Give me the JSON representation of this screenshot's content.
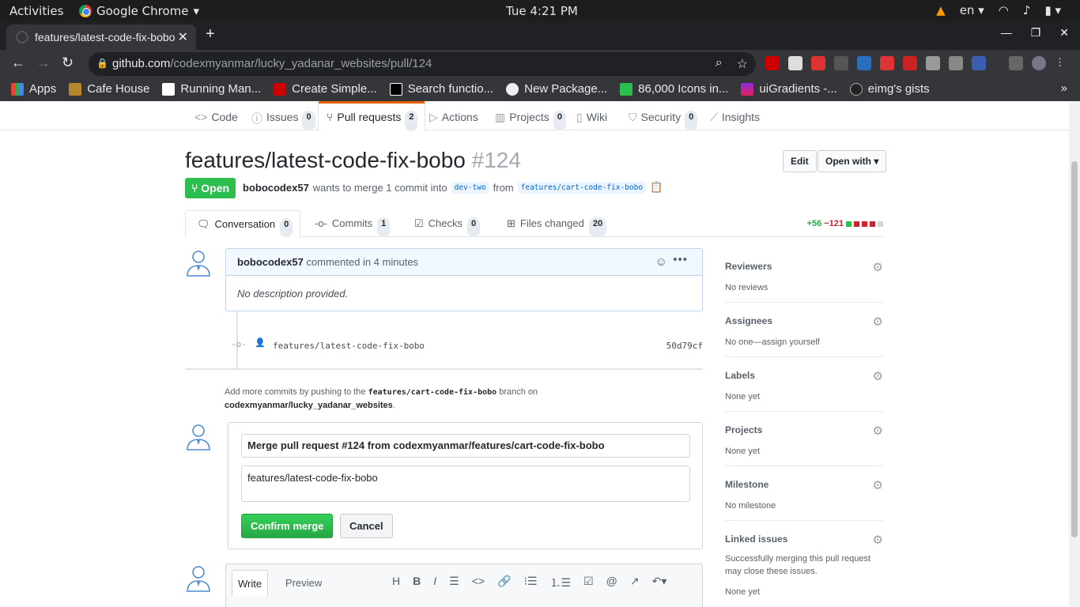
{
  "gnome": {
    "activities": "Activities",
    "app": "Google Chrome",
    "clock": "Tue  4:21 PM",
    "lang": "en"
  },
  "browser": {
    "tab_title": "features/latest-code-fix-bobo",
    "url_host": "github.com",
    "url_path": "/codexmyanmar/lucky_yadanar_websites/pull/124",
    "bookmarks": [
      "Apps",
      "Cafe House",
      "Running Man...",
      "Create Simple...",
      "Search functio...",
      "New Package...",
      "86,000 Icons in...",
      "uiGradients -...",
      "eimg's gists"
    ]
  },
  "reponav": {
    "items": [
      {
        "label": "Code",
        "icon": "code-icon"
      },
      {
        "label": "Issues",
        "count": "0",
        "icon": "issue-icon"
      },
      {
        "label": "Pull requests",
        "count": "2",
        "icon": "pull-request-icon"
      },
      {
        "label": "Actions",
        "icon": "play-icon"
      },
      {
        "label": "Projects",
        "count": "0",
        "icon": "project-icon"
      },
      {
        "label": "Wiki",
        "icon": "book-icon"
      },
      {
        "label": "Security",
        "count": "0",
        "icon": "shield-icon"
      },
      {
        "label": "Insights",
        "icon": "graph-icon"
      }
    ]
  },
  "pr": {
    "title": "features/latest-code-fix-bobo",
    "number": "#124",
    "edit_label": "Edit",
    "open_with_label": "Open with",
    "state": "Open",
    "author": "bobocodex57",
    "meta_text": "wants to merge 1 commit into",
    "base": "dev-two",
    "from_text": "from",
    "head": "features/cart-code-fix-bobo"
  },
  "tabs": [
    {
      "label": "Conversation",
      "count": "0"
    },
    {
      "label": "Commits",
      "count": "1"
    },
    {
      "label": "Checks",
      "count": "0"
    },
    {
      "label": "Files changed",
      "count": "20"
    }
  ],
  "diffstat": {
    "additions": "+56",
    "deletions": "−121"
  },
  "comment": {
    "author": "bobocodex57",
    "action": "commented in 4 minutes",
    "body": "No description provided."
  },
  "commit": {
    "message": "features/latest-code-fix-bobo",
    "sha": "50d79cf"
  },
  "hint": {
    "pre": "Add more commits by pushing to the",
    "branch": "features/cart-code-fix-bobo",
    "mid": "branch on",
    "repo": "codexmyanmar/lucky_yadanar_websites",
    "end": "."
  },
  "merge": {
    "title": "Merge pull request #124 from codexmyanmar/features/cart-code-fix-bobo",
    "body": "features/latest-code-fix-bobo",
    "confirm": "Confirm merge",
    "cancel": "Cancel"
  },
  "editor": {
    "write": "Write",
    "preview": "Preview"
  },
  "sidebar": [
    {
      "label": "Reviewers",
      "value": "No reviews"
    },
    {
      "label": "Assignees",
      "value": "No one—assign yourself"
    },
    {
      "label": "Labels",
      "value": "None yet"
    },
    {
      "label": "Projects",
      "value": "None yet"
    },
    {
      "label": "Milestone",
      "value": "No milestone"
    },
    {
      "label": "Linked issues",
      "value": "Successfully merging this pull request may close these issues.",
      "value2": "None yet"
    }
  ],
  "colors": {
    "accent": "#e36209",
    "green": "#2cbe4e",
    "link": "#0366d6"
  }
}
